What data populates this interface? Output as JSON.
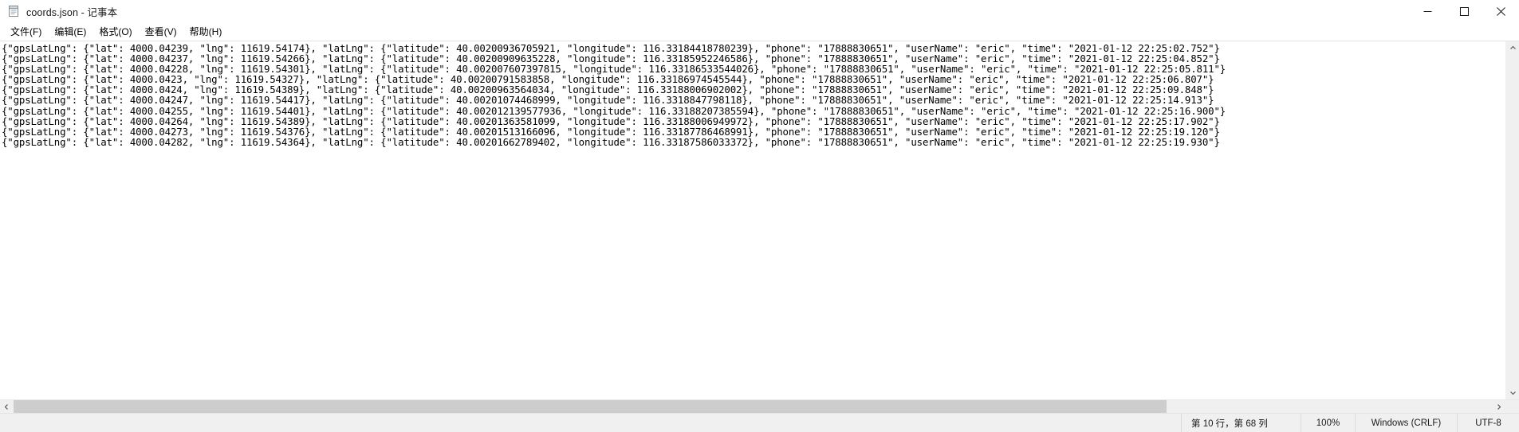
{
  "window": {
    "title": "coords.json - 记事本",
    "icon": "notepad-icon",
    "controls": {
      "minimize": "–",
      "maximize": "▢",
      "close": "✕"
    }
  },
  "menubar": {
    "items": [
      {
        "label": "文件(F)",
        "name": "menu-file"
      },
      {
        "label": "编辑(E)",
        "name": "menu-edit"
      },
      {
        "label": "格式(O)",
        "name": "menu-format"
      },
      {
        "label": "查看(V)",
        "name": "menu-view"
      },
      {
        "label": "帮助(H)",
        "name": "menu-help"
      }
    ]
  },
  "editor": {
    "lines": [
      "{\"gpsLatLng\": {\"lat\": 4000.04239, \"lng\": 11619.54174}, \"latLng\": {\"latitude\": 40.00200936705921, \"longitude\": 116.33184418780239}, \"phone\": \"17888830651\", \"userName\": \"eric\", \"time\": \"2021-01-12 22:25:02.752\"}",
      "{\"gpsLatLng\": {\"lat\": 4000.04237, \"lng\": 11619.54266}, \"latLng\": {\"latitude\": 40.00200909635228, \"longitude\": 116.33185952246586}, \"phone\": \"17888830651\", \"userName\": \"eric\", \"time\": \"2021-01-12 22:25:04.852\"}",
      "{\"gpsLatLng\": {\"lat\": 4000.04228, \"lng\": 11619.54301}, \"latLng\": {\"latitude\": 40.002007607397815, \"longitude\": 116.33186533544026}, \"phone\": \"17888830651\", \"userName\": \"eric\", \"time\": \"2021-01-12 22:25:05.811\"}",
      "{\"gpsLatLng\": {\"lat\": 4000.0423, \"lng\": 11619.54327}, \"latLng\": {\"latitude\": 40.00200791583858, \"longitude\": 116.33186974545544}, \"phone\": \"17888830651\", \"userName\": \"eric\", \"time\": \"2021-01-12 22:25:06.807\"}",
      "{\"gpsLatLng\": {\"lat\": 4000.0424, \"lng\": 11619.54389}, \"latLng\": {\"latitude\": 40.00200963564034, \"longitude\": 116.33188006902002}, \"phone\": \"17888830651\", \"userName\": \"eric\", \"time\": \"2021-01-12 22:25:09.848\"}",
      "{\"gpsLatLng\": {\"lat\": 4000.04247, \"lng\": 11619.54417}, \"latLng\": {\"latitude\": 40.00201074468999, \"longitude\": 116.3318847798118}, \"phone\": \"17888830651\", \"userName\": \"eric\", \"time\": \"2021-01-12 22:25:14.913\"}",
      "{\"gpsLatLng\": {\"lat\": 4000.04255, \"lng\": 11619.54401}, \"latLng\": {\"latitude\": 40.002012139577936, \"longitude\": 116.33188207385594}, \"phone\": \"17888830651\", \"userName\": \"eric\", \"time\": \"2021-01-12 22:25:16.900\"}",
      "{\"gpsLatLng\": {\"lat\": 4000.04264, \"lng\": 11619.54389}, \"latLng\": {\"latitude\": 40.00201363581099, \"longitude\": 116.33188006949972}, \"phone\": \"17888830651\", \"userName\": \"eric\", \"time\": \"2021-01-12 22:25:17.902\"}",
      "{\"gpsLatLng\": {\"lat\": 4000.04273, \"lng\": 11619.54376}, \"latLng\": {\"latitude\": 40.00201513166096, \"longitude\": 116.33187786468991}, \"phone\": \"17888830651\", \"userName\": \"eric\", \"time\": \"2021-01-12 22:25:19.120\"}",
      "{\"gpsLatLng\": {\"lat\": 4000.04282, \"lng\": 11619.54364}, \"latLng\": {\"latitude\": 40.00201662789402, \"longitude\": 116.33187586033372}, \"phone\": \"17888830651\", \"userName\": \"eric\", \"time\": \"2021-01-12 22:25:19.930\"}"
    ]
  },
  "scrollbars": {
    "vertical_up": "⌃",
    "vertical_down": "⌄",
    "horizontal_left": "‹",
    "horizontal_right": "›"
  },
  "statusbar": {
    "position": "第 10 行，第 68 列",
    "zoom": "100%",
    "line_ending": "Windows (CRLF)",
    "encoding": "UTF-8"
  }
}
